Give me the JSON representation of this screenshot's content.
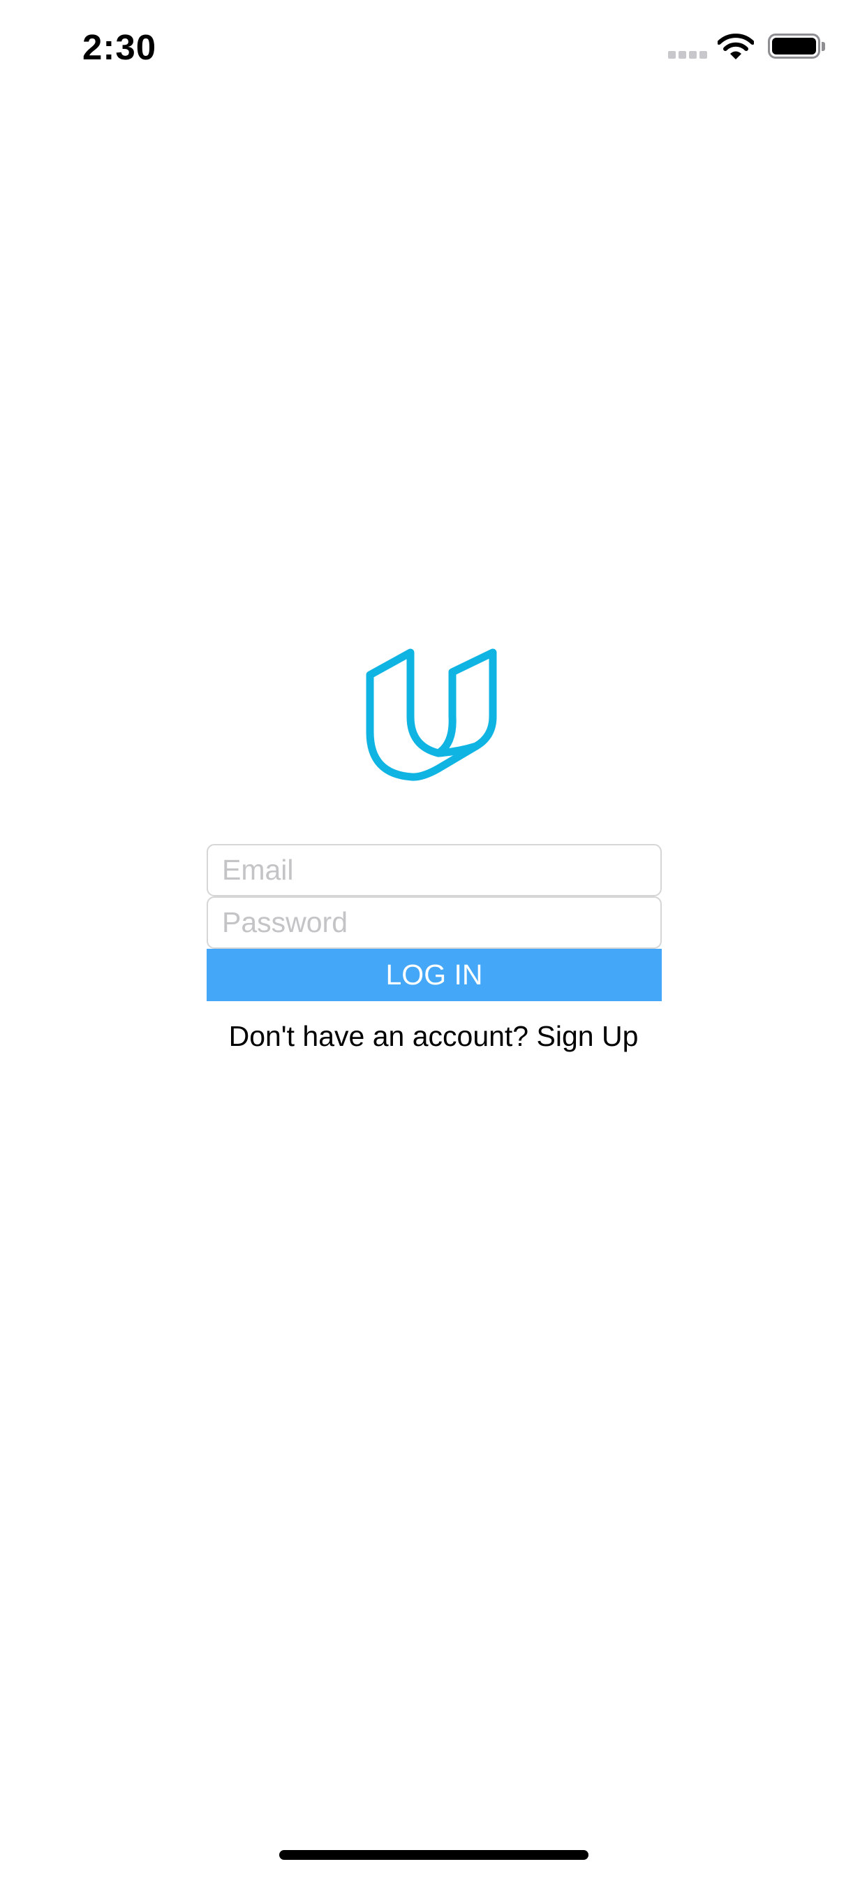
{
  "status_bar": {
    "time": "2:30",
    "icons": {
      "signal": "cellular-signal-icon",
      "wifi": "wifi-icon",
      "battery": "battery-full-icon"
    }
  },
  "logo": {
    "icon": "udacity-logo-icon",
    "color": "#0fb4e3"
  },
  "login_form": {
    "email": {
      "value": "",
      "placeholder": "Email"
    },
    "password": {
      "value": "",
      "placeholder": "Password"
    },
    "login_label": "LOG IN",
    "login_color": "#45a7f7",
    "signup_prompt": "Don't have an account?",
    "signup_link": "Sign Up"
  }
}
